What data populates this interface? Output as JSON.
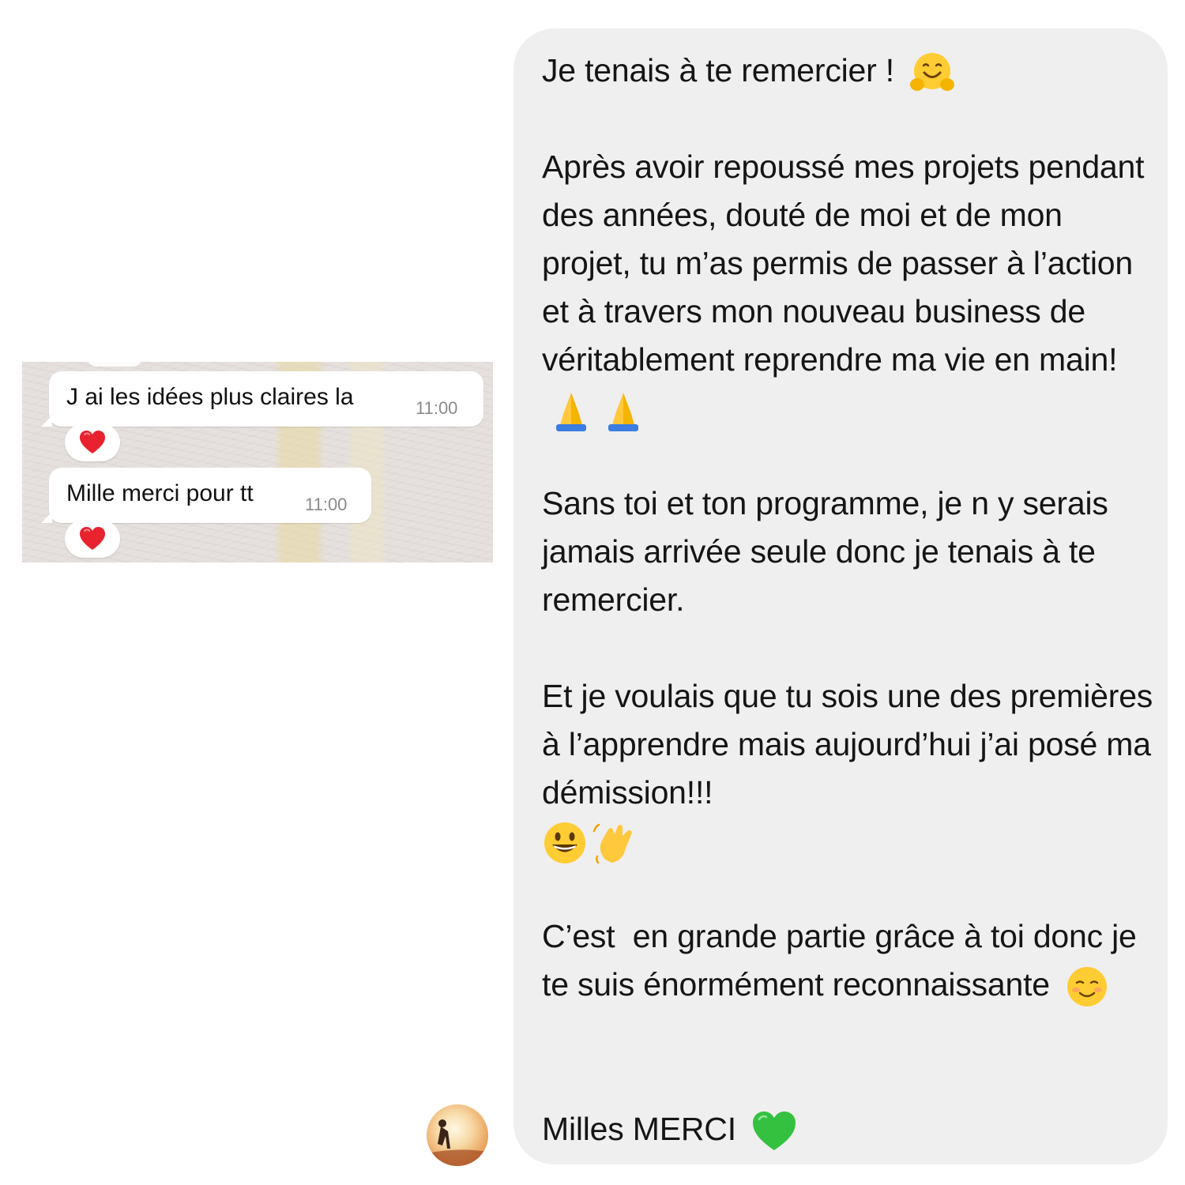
{
  "whatsapp": {
    "messages": [
      {
        "text": "J ai les idées plus claires la",
        "time": "11:00",
        "reaction": "red-heart"
      },
      {
        "text": "Mille merci pour tt",
        "time": "11:00",
        "reaction": "red-heart"
      }
    ],
    "colors": {
      "bubble": "#ffffff",
      "time": "#8a8a8a"
    }
  },
  "messenger": {
    "paragraphs": [
      {
        "text": "Je tenais à te remercier !",
        "emojis": [
          "hugging-face-emoji"
        ]
      },
      {
        "text": "Après avoir repoussé mes projets pendant des années, douté de moi et de mon projet, tu m’as permis de passer à l’action et à travers mon nouveau business de véritablement reprendre ma vie en main!",
        "emojis": [
          "folded-hands-emoji",
          "folded-hands-emoji"
        ]
      },
      {
        "text": "Sans toi et ton programme, je n y serais jamais arrivée seule donc je tenais à te remercier.",
        "emojis": []
      },
      {
        "text": "Et je voulais que tu sois une des premières à l’apprendre mais aujourd’hui j’ai posé ma démission!!!",
        "emojis": [
          "grinning-face-emoji",
          "waving-hand-emoji"
        ]
      },
      {
        "text": "C’est  en grande partie grâce à toi donc je te suis énormément reconnaissante",
        "emojis": [
          "smiling-face-emoji"
        ]
      },
      {
        "text": "Milles MERCI",
        "emojis": [
          "green-heart-emoji"
        ]
      }
    ],
    "colors": {
      "bubble": "#efefef",
      "text": "#151515"
    }
  },
  "avatar": {
    "icon": "sender-avatar"
  }
}
